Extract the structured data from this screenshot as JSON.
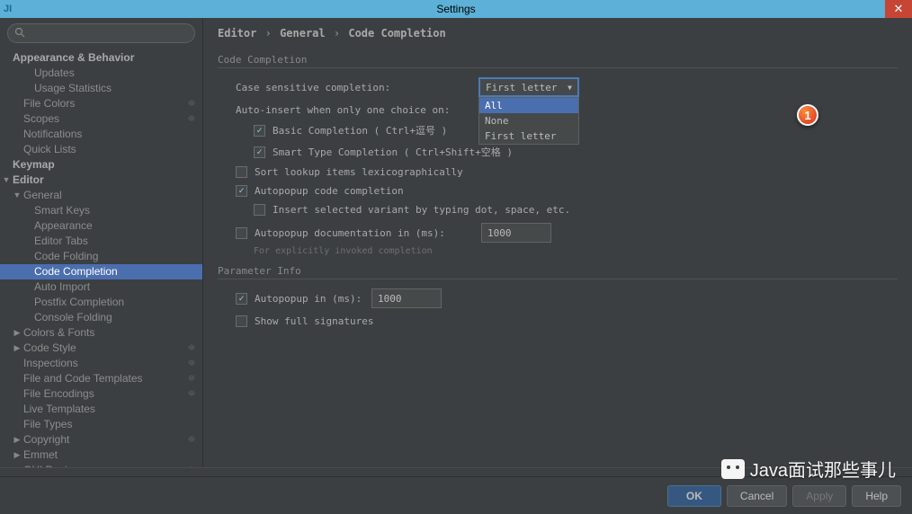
{
  "window": {
    "title": "Settings",
    "icon": "JI"
  },
  "search": {
    "placeholder": ""
  },
  "sidebar": {
    "items": [
      {
        "label": "Appearance & Behavior",
        "level": 0,
        "bold": true,
        "arrow": ""
      },
      {
        "label": "Updates",
        "level": 2
      },
      {
        "label": "Usage Statistics",
        "level": 2
      },
      {
        "label": "File Colors",
        "level": 1,
        "gear": true
      },
      {
        "label": "Scopes",
        "level": 1,
        "gear": true
      },
      {
        "label": "Notifications",
        "level": 1
      },
      {
        "label": "Quick Lists",
        "level": 1
      },
      {
        "label": "Keymap",
        "level": 0,
        "bold": true
      },
      {
        "label": "Editor",
        "level": 0,
        "bold": true,
        "arrow": "▼"
      },
      {
        "label": "General",
        "level": 1,
        "arrow": "▼"
      },
      {
        "label": "Smart Keys",
        "level": 2
      },
      {
        "label": "Appearance",
        "level": 2
      },
      {
        "label": "Editor Tabs",
        "level": 2
      },
      {
        "label": "Code Folding",
        "level": 2
      },
      {
        "label": "Code Completion",
        "level": 2,
        "selected": true
      },
      {
        "label": "Auto Import",
        "level": 2
      },
      {
        "label": "Postfix Completion",
        "level": 2
      },
      {
        "label": "Console Folding",
        "level": 2
      },
      {
        "label": "Colors & Fonts",
        "level": 1,
        "arrow": "▶"
      },
      {
        "label": "Code Style",
        "level": 1,
        "arrow": "▶",
        "gear": true
      },
      {
        "label": "Inspections",
        "level": 1,
        "gear": true
      },
      {
        "label": "File and Code Templates",
        "level": 1,
        "gear": true
      },
      {
        "label": "File Encodings",
        "level": 1,
        "gear": true
      },
      {
        "label": "Live Templates",
        "level": 1
      },
      {
        "label": "File Types",
        "level": 1
      },
      {
        "label": "Copyright",
        "level": 1,
        "arrow": "▶",
        "gear": true
      },
      {
        "label": "Emmet",
        "level": 1,
        "arrow": "▶"
      },
      {
        "label": "GUI Designer",
        "level": 1,
        "gear": true
      }
    ]
  },
  "breadcrumb": {
    "p1": "Editor",
    "p2": "General",
    "p3": "Code Completion"
  },
  "section1": {
    "title": "Code Completion",
    "case_label": "Case sensitive completion:",
    "case_value": "First letter",
    "dropdown": [
      "All",
      "None",
      "First letter"
    ],
    "auto_insert_label": "Auto-insert when only one choice on:",
    "basic_label": "Basic Completion ( Ctrl+逗号 )",
    "smart_label": "Smart Type Completion ( Ctrl+Shift+空格 )",
    "sort_label": "Sort lookup items lexicographically",
    "autopop_label": "Autopopup code completion",
    "insert_variant_label": "Insert selected variant by typing dot, space, etc.",
    "autopop_doc_label": "Autopopup documentation in (ms):",
    "autopop_doc_value": "1000",
    "hint": "For explicitly invoked completion"
  },
  "section2": {
    "title": "Parameter Info",
    "autopop_label": "Autopopup in (ms):",
    "autopop_value": "1000",
    "fullsig_label": "Show full signatures"
  },
  "callout": "1",
  "buttons": {
    "ok": "OK",
    "cancel": "Cancel",
    "apply": "Apply",
    "help": "Help"
  },
  "watermark": "Java面试那些事儿"
}
